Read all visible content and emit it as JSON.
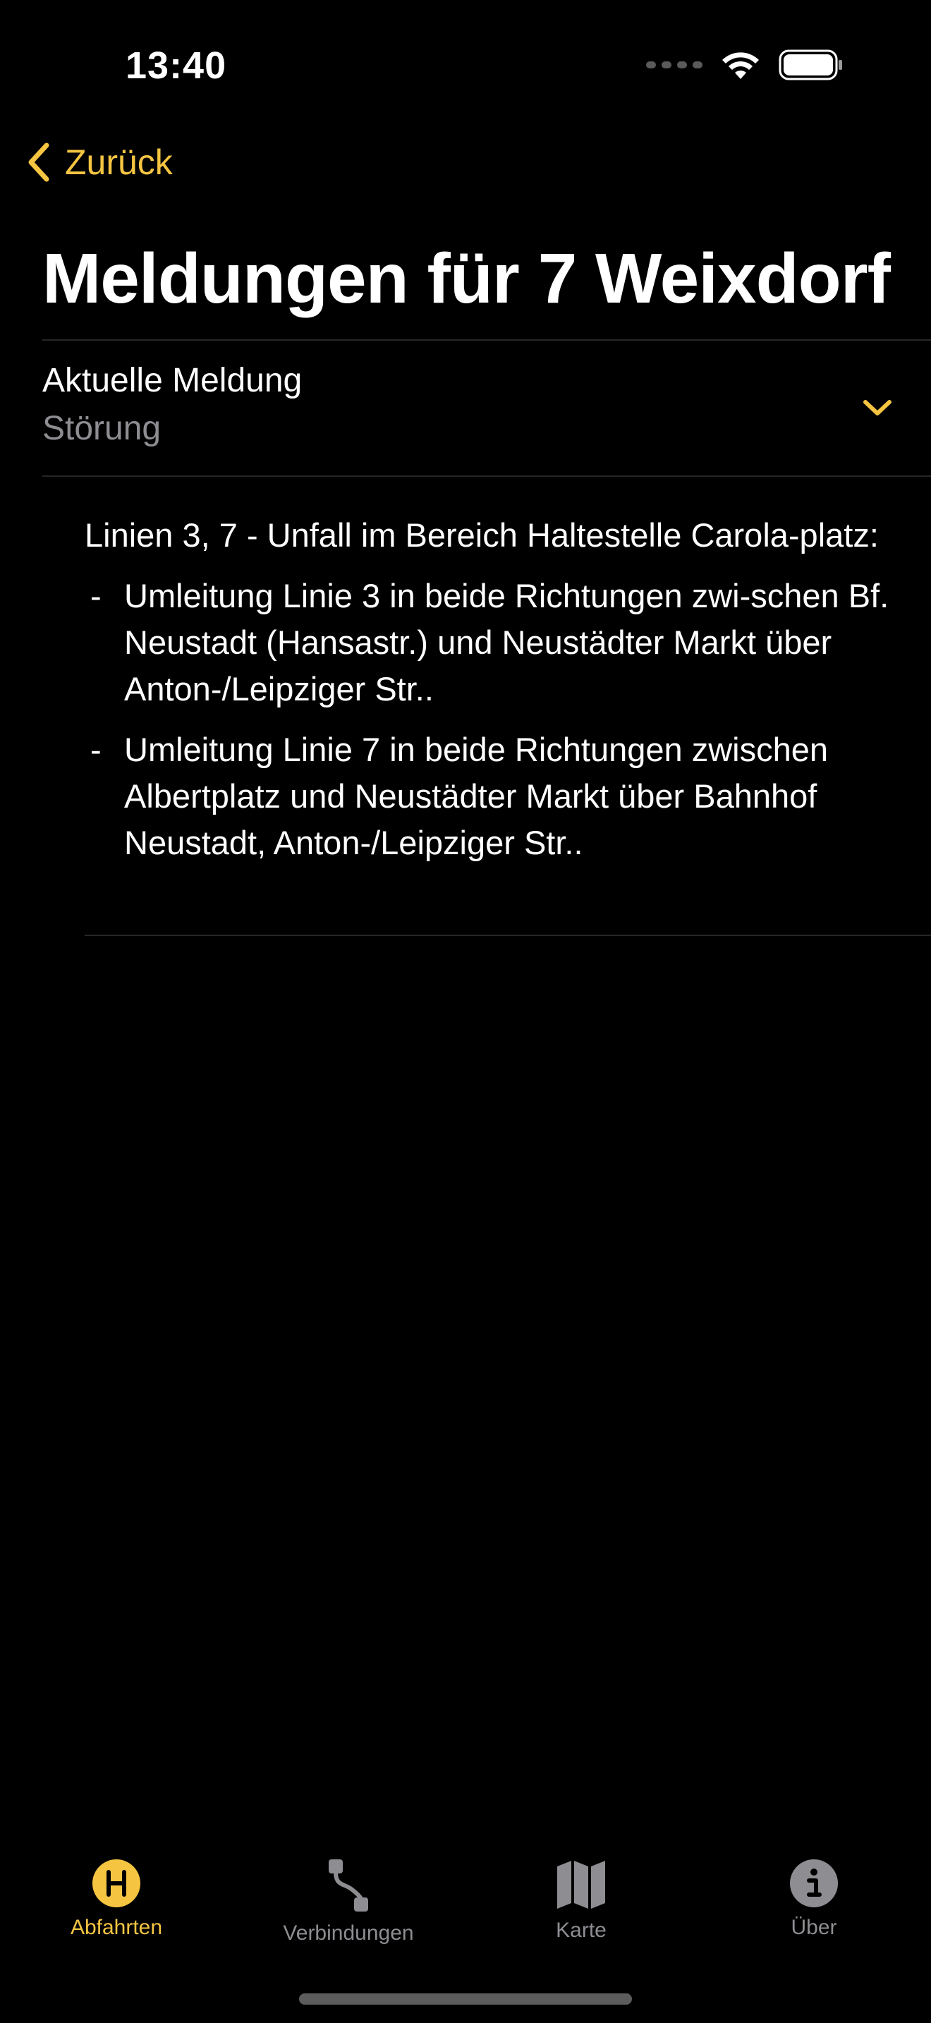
{
  "status_bar": {
    "time": "13:40"
  },
  "nav": {
    "back_label": "Zurück",
    "title": "Meldungen für 7 Weixdorf"
  },
  "disclosure": {
    "title": "Aktuelle Meldung",
    "subtitle": "Störung",
    "expanded": true
  },
  "message": {
    "intro": "Linien 3, 7 - Unfall im Bereich Haltestelle Carola-platz:",
    "items": [
      {
        "dash": "-",
        "text": "Umleitung Linie 3 in beide Richtungen zwi-schen Bf. Neustadt (Hansastr.) und Neustädter Markt über Anton-/Leipziger Str.."
      },
      {
        "dash": "-",
        "text": "Umleitung Linie 7 in beide Richtungen zwischen Albertplatz und Neustädter Markt über Bahnhof Neustadt, Anton-/Leipziger Str.."
      }
    ]
  },
  "tab_bar": {
    "tabs": [
      {
        "label": "Abfahrten",
        "icon": "haltestelle-h-icon",
        "active": true
      },
      {
        "label": "Verbindungen",
        "icon": "route-icon",
        "active": false
      },
      {
        "label": "Karte",
        "icon": "map-icon",
        "active": false
      },
      {
        "label": "Über",
        "icon": "info-icon",
        "active": false
      }
    ]
  },
  "colors": {
    "accent": "#f5c542",
    "background": "#000000",
    "secondary_text": "#8d8d92",
    "separator": "#262626"
  }
}
